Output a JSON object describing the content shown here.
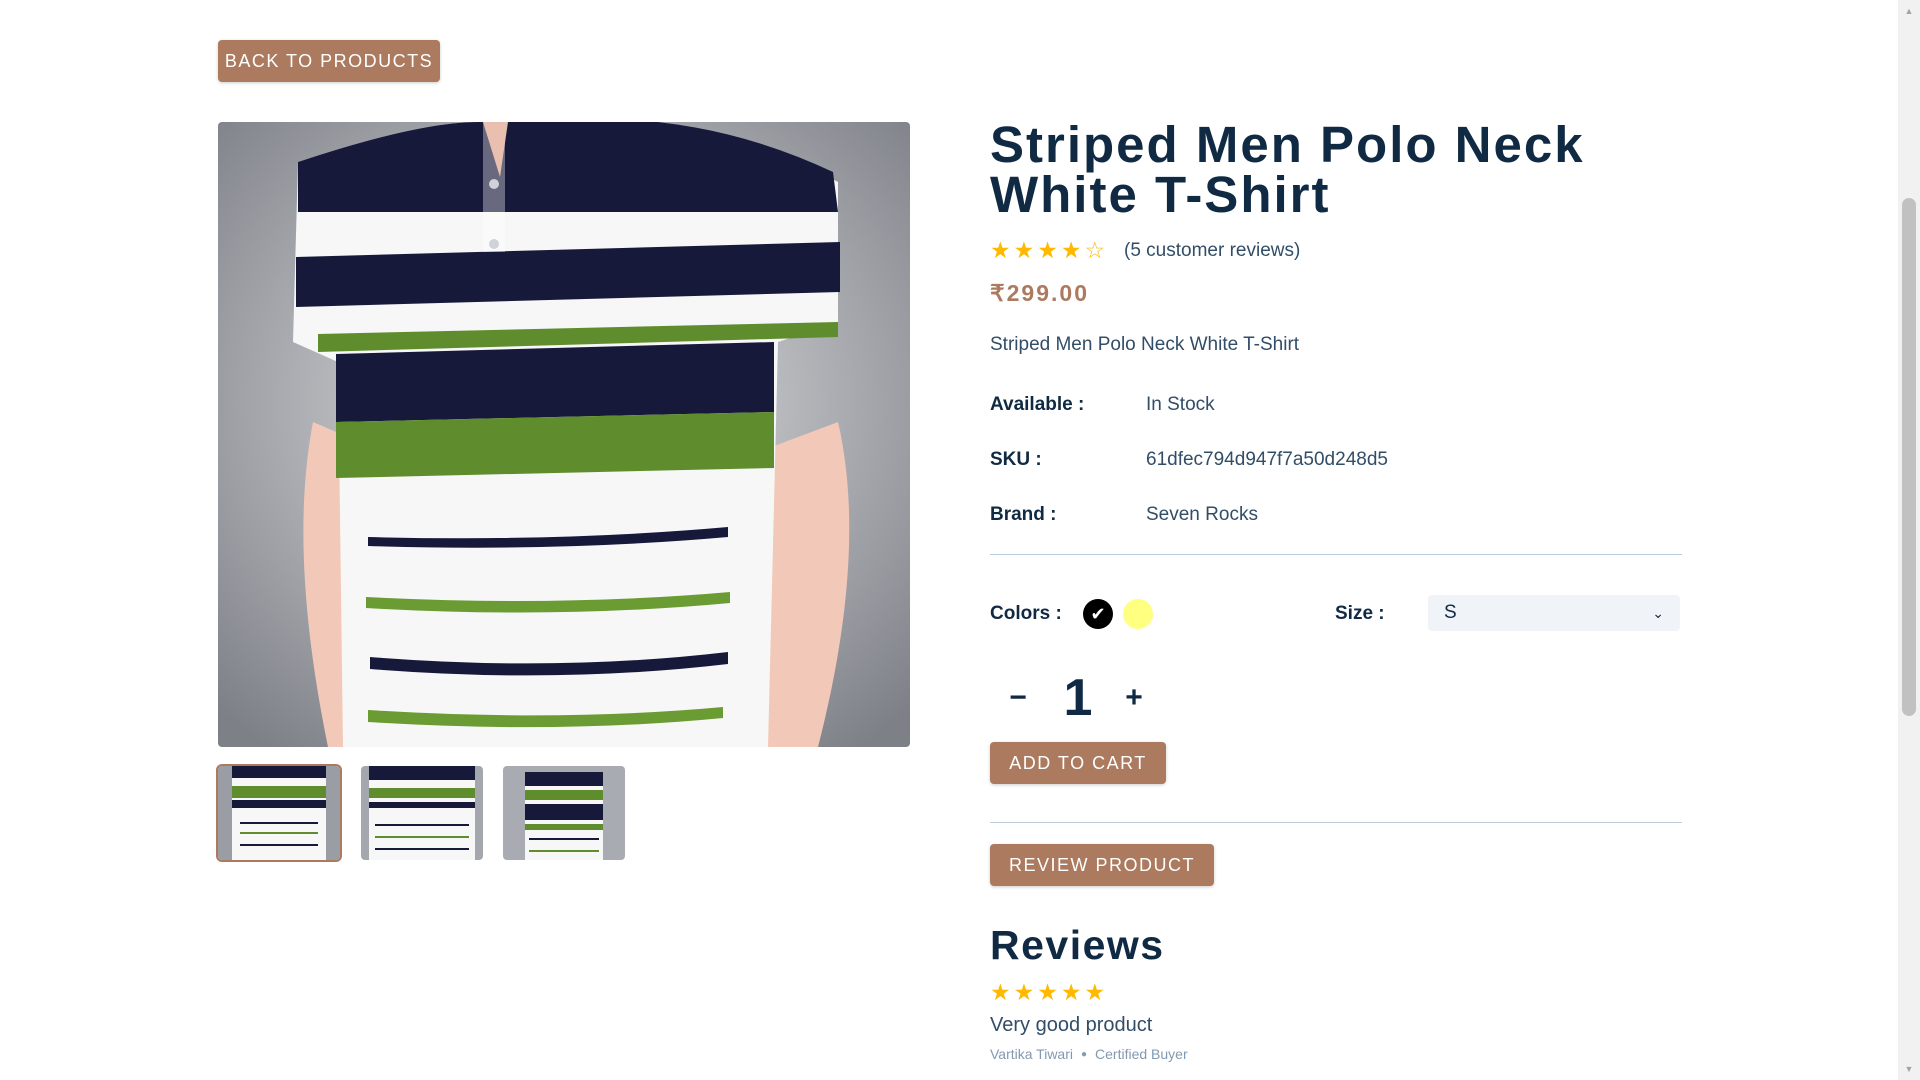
{
  "back_button": "BACK TO PRODUCTS",
  "product": {
    "title": "Striped Men Polo Neck White T-Shirt",
    "rating": 4,
    "rating_max": 5,
    "reviews_count_text": "(5 customer reviews)",
    "price": "₹299.00",
    "description": "Striped Men Polo Neck White T-Shirt",
    "available_label": "Available :",
    "available_value": "In Stock",
    "sku_label": "SKU :",
    "sku_value": "61dfec794d947f7a50d248d5",
    "brand_label": "Brand :",
    "brand_value": "Seven Rocks",
    "colors_label": "Colors :",
    "colors": [
      "#000000",
      "#ffff80"
    ],
    "selected_color": "#000000",
    "size_label": "Size :",
    "size_selected": "S",
    "quantity": "1",
    "minus_label": "−",
    "plus_label": "+",
    "add_to_cart": "ADD TO CART",
    "review_button": "REVIEW PRODUCT"
  },
  "images": {
    "thumbnails_count": 3,
    "active_index": 0
  },
  "reviews": {
    "heading": "Reviews",
    "items": [
      {
        "rating": 5,
        "text": "Very good product",
        "author": "Vartika Tiwari",
        "badge": "Certified Buyer"
      }
    ]
  },
  "colors": {
    "accent": "#ab7a5f",
    "heading": "#102a43",
    "star": "#ffb900"
  },
  "icons": {
    "check": "check-icon",
    "star": "star-icon",
    "chevron": "chevron-down-icon"
  }
}
